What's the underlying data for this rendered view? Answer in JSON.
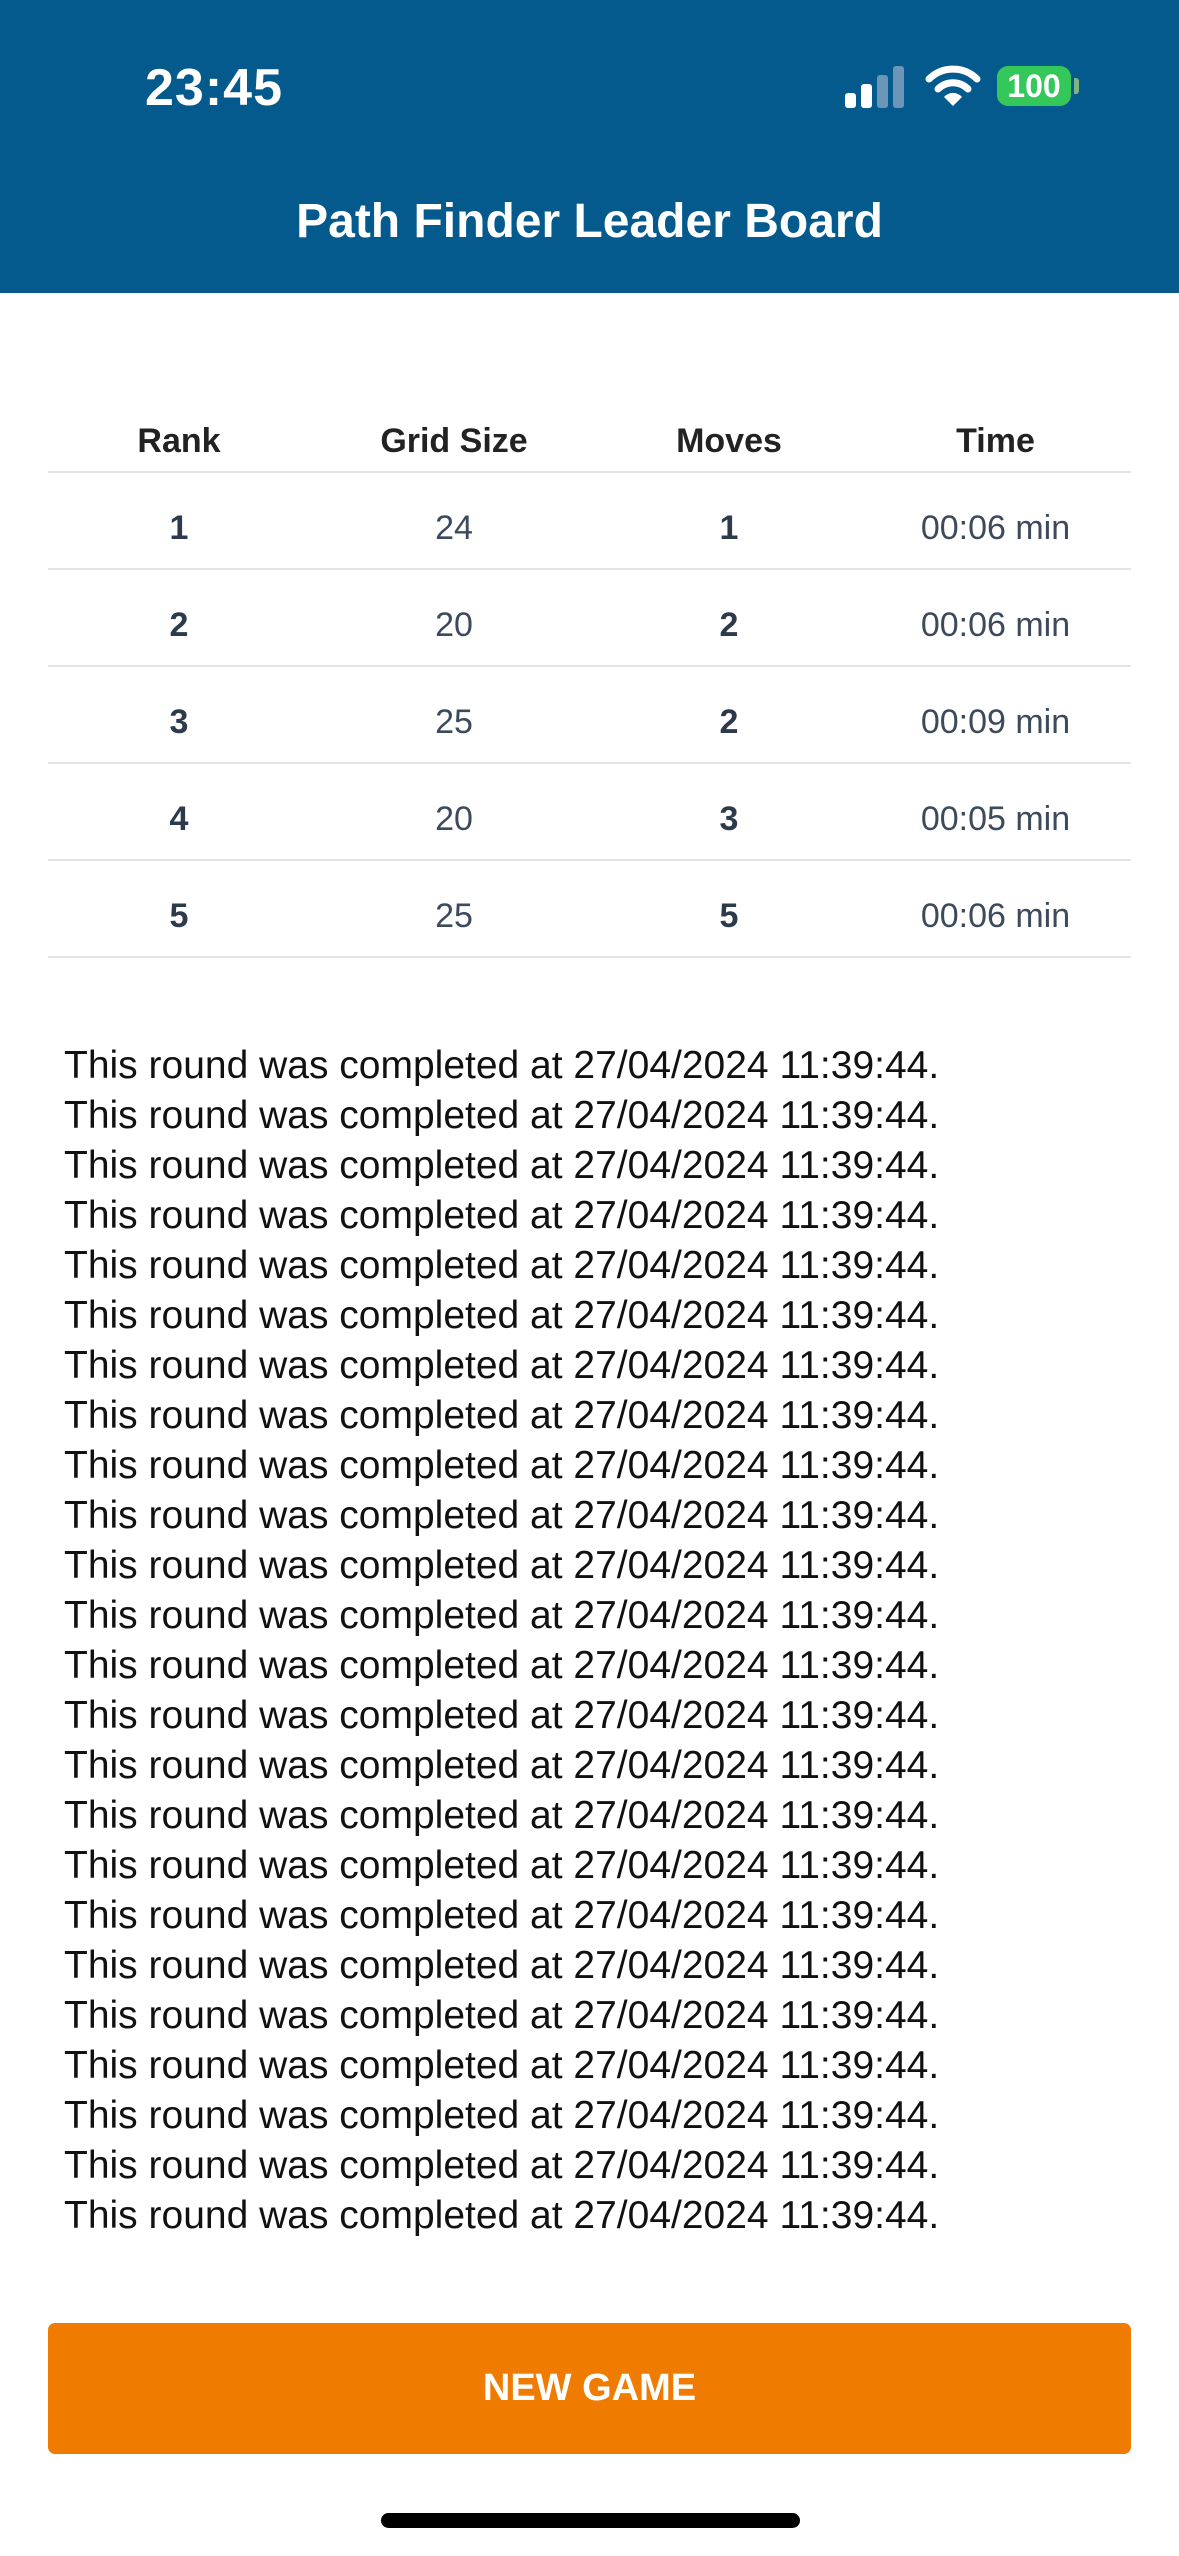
{
  "status_bar": {
    "time": "23:45",
    "battery": "100",
    "icons": [
      "cellular-signal-icon",
      "wifi-icon",
      "battery-icon"
    ]
  },
  "header": {
    "title": "Path Finder Leader Board"
  },
  "leaderboard": {
    "columns": [
      "Rank",
      "Grid Size",
      "Moves",
      "Time"
    ],
    "rows": [
      {
        "rank": "1",
        "grid_size": "24",
        "moves": "1",
        "time": "00:06 min"
      },
      {
        "rank": "2",
        "grid_size": "20",
        "moves": "2",
        "time": "00:06 min"
      },
      {
        "rank": "3",
        "grid_size": "25",
        "moves": "2",
        "time": "00:09 min"
      },
      {
        "rank": "4",
        "grid_size": "20",
        "moves": "3",
        "time": "00:05 min"
      },
      {
        "rank": "5",
        "grid_size": "25",
        "moves": "5",
        "time": "00:06 min"
      }
    ]
  },
  "completion_log": [
    "This round was completed at 27/04/2024 11:39:44.",
    "This round was completed at 27/04/2024 11:39:44.",
    "This round was completed at 27/04/2024 11:39:44.",
    "This round was completed at 27/04/2024 11:39:44.",
    "This round was completed at 27/04/2024 11:39:44.",
    "This round was completed at 27/04/2024 11:39:44.",
    "This round was completed at 27/04/2024 11:39:44.",
    "This round was completed at 27/04/2024 11:39:44.",
    "This round was completed at 27/04/2024 11:39:44.",
    "This round was completed at 27/04/2024 11:39:44.",
    "This round was completed at 27/04/2024 11:39:44.",
    "This round was completed at 27/04/2024 11:39:44.",
    "This round was completed at 27/04/2024 11:39:44.",
    "This round was completed at 27/04/2024 11:39:44.",
    "This round was completed at 27/04/2024 11:39:44.",
    "This round was completed at 27/04/2024 11:39:44.",
    "This round was completed at 27/04/2024 11:39:44.",
    "This round was completed at 27/04/2024 11:39:44.",
    "This round was completed at 27/04/2024 11:39:44.",
    "This round was completed at 27/04/2024 11:39:44.",
    "This round was completed at 27/04/2024 11:39:44.",
    "This round was completed at 27/04/2024 11:39:44.",
    "This round was completed at 27/04/2024 11:39:44.",
    "This round was completed at 27/04/2024 11:39:44."
  ],
  "actions": {
    "new_game_label": "NEW GAME"
  },
  "colors": {
    "header_bg": "#045a8d",
    "button_bg": "#ef7c00",
    "battery": "#34c759",
    "divider": "#e4e4e4"
  }
}
